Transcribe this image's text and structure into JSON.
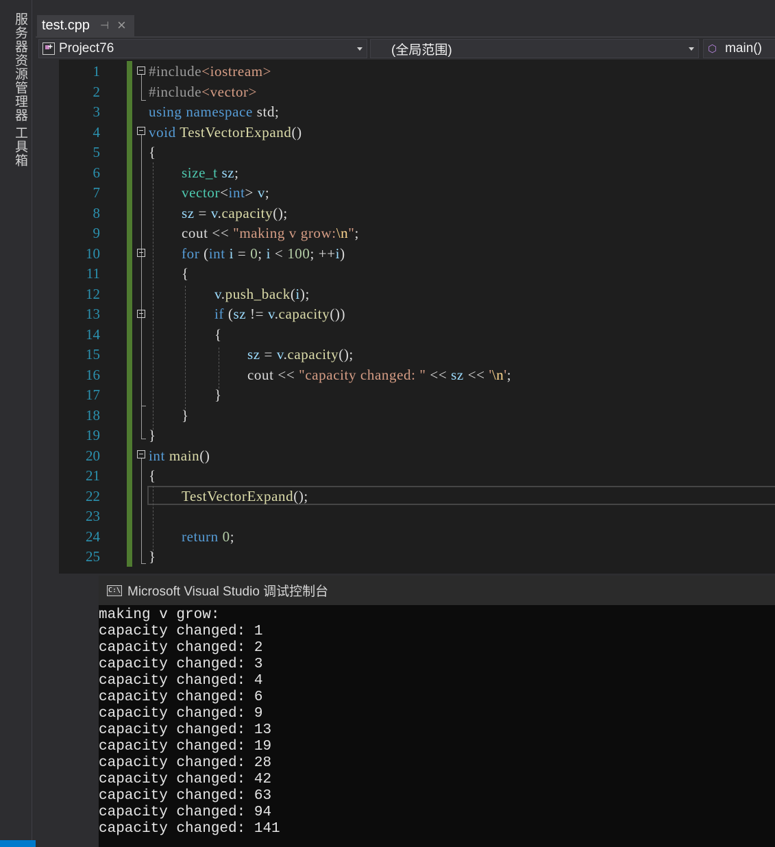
{
  "sidebar": {
    "tab1": "服务器资源管理器",
    "tab2": "工具箱"
  },
  "tab": {
    "file_name": "test.cpp",
    "pin_icon": "pin-icon",
    "close_icon": "close-icon"
  },
  "nav": {
    "project": "Project76",
    "scope": "(全局范围)",
    "member": "main()"
  },
  "editor": {
    "line_numbers": [
      "1",
      "2",
      "3",
      "4",
      "5",
      "6",
      "7",
      "8",
      "9",
      "10",
      "11",
      "12",
      "13",
      "14",
      "15",
      "16",
      "17",
      "18",
      "19",
      "20",
      "21",
      "22",
      "23",
      "24",
      "25"
    ],
    "current_line": 22
  },
  "console": {
    "title": "Microsoft Visual Studio 调试控制台",
    "icon_text": "C:\\",
    "lines": [
      "making v grow:",
      "capacity changed: 1",
      "capacity changed: 2",
      "capacity changed: 3",
      "capacity changed: 4",
      "capacity changed: 6",
      "capacity changed: 9",
      "capacity changed: 13",
      "capacity changed: 19",
      "capacity changed: 28",
      "capacity changed: 42",
      "capacity changed: 63",
      "capacity changed: 94",
      "capacity changed: 141"
    ]
  },
  "colors": {
    "accent": "#007acc",
    "line_number": "#2b91af",
    "keyword": "#569cd6",
    "type": "#4ec9b0",
    "function": "#dcdcaa",
    "string": "#d69d85",
    "change_bar": "#4f7b30"
  }
}
